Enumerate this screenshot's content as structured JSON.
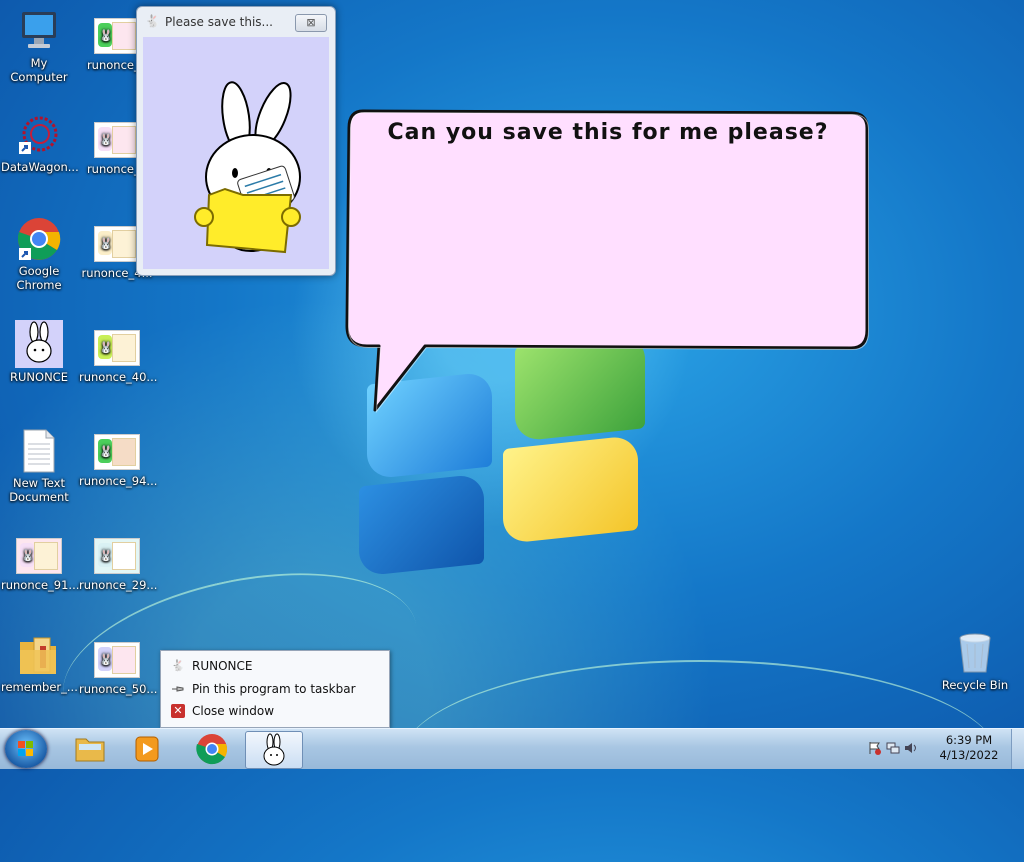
{
  "small_window": {
    "title": "Please save this...",
    "close_glyph": "⊠"
  },
  "speech_bubble": {
    "text": "Can you save this for me please?"
  },
  "desktop_icons": {
    "my_computer": "My Computer",
    "runonce_3": "runonce_3",
    "datawagon": "DataWagon...",
    "runonce_7": "runonce_7",
    "google_chrome": "Google Chrome",
    "runonce_4a": "runonce_4...",
    "runonce_app": "RUNONCE",
    "runonce_40": "runonce_40...",
    "new_text_document": "New Text Document",
    "runonce_94": "runonce_94...",
    "runonce_91": "runonce_91...",
    "runonce_29": "runonce_29...",
    "remember": "remember_...",
    "runonce_50": "runonce_50...",
    "recycle_bin": "Recycle Bin"
  },
  "context_menu": {
    "app_name": "RUNONCE",
    "pin": "Pin this program to taskbar",
    "close": "Close window"
  },
  "taskbar": {
    "clock_time": "6:39 PM",
    "clock_date": "4/13/2022"
  },
  "colors": {
    "bubble_fill": "#ffdfff",
    "window_client": "#d3d2fa",
    "desktop_blue": "#1477c8"
  }
}
